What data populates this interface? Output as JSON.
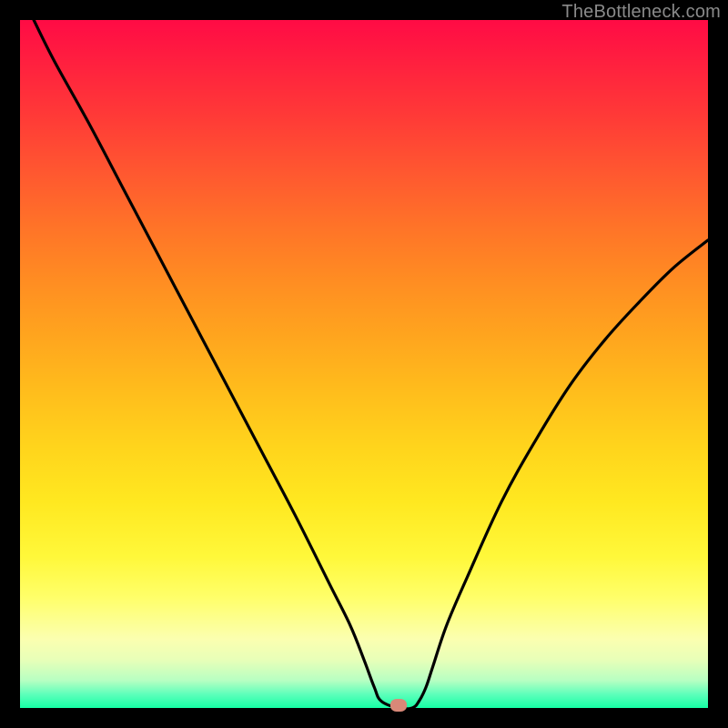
{
  "watermark": "TheBottleneck.com",
  "marker": {
    "color": "#d98878"
  },
  "chart_data": {
    "type": "line",
    "title": "",
    "xlabel": "",
    "ylabel": "",
    "xlim": [
      0,
      100
    ],
    "ylim": [
      0,
      100
    ],
    "grid": false,
    "legend": false,
    "notes": "V-shaped curve on rainbow gradient; minimum near x≈55 at y≈0; single small rounded marker at the minimum.",
    "x": [
      2,
      5,
      10,
      15,
      20,
      25,
      30,
      35,
      40,
      45,
      48,
      50,
      51.5,
      52.5,
      55,
      57,
      58,
      59,
      60,
      62,
      65,
      70,
      75,
      80,
      85,
      90,
      95,
      100
    ],
    "values": [
      100,
      94,
      85,
      75.5,
      66,
      56.5,
      47,
      37.5,
      28,
      18,
      12,
      7,
      3,
      1,
      0,
      0,
      1,
      3,
      6,
      12,
      19,
      30,
      39,
      47,
      53.5,
      59,
      64,
      68
    ],
    "marker_x": 55,
    "marker_y": 0
  }
}
